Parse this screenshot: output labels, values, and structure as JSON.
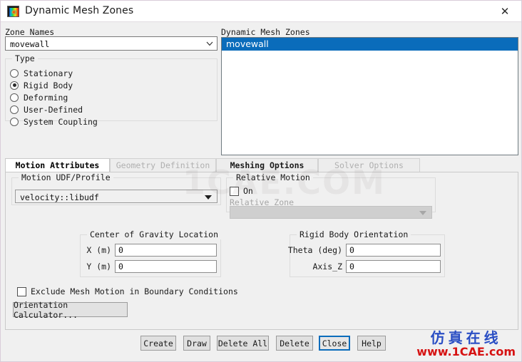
{
  "window": {
    "title": "Dynamic Mesh Zones",
    "icon": "fluent-contour-icon",
    "close_label": "✕"
  },
  "left": {
    "zone_names_label": "Zone Names",
    "zone_combo_value": "movewall",
    "type_group_label": "Type",
    "type_options": [
      {
        "label": "Stationary",
        "checked": false
      },
      {
        "label": "Rigid Body",
        "checked": true
      },
      {
        "label": "Deforming",
        "checked": false
      },
      {
        "label": "User-Defined",
        "checked": false
      },
      {
        "label": "System Coupling",
        "checked": false
      }
    ]
  },
  "right": {
    "list_label": "Dynamic Mesh Zones",
    "items": [
      {
        "label": "movewall",
        "selected": true
      }
    ]
  },
  "tabs": [
    {
      "label": "Motion Attributes",
      "active": true,
      "disabled": false
    },
    {
      "label": "Geometry Definition",
      "active": false,
      "disabled": true
    },
    {
      "label": "Meshing Options",
      "active": false,
      "disabled": false
    },
    {
      "label": "Solver Options",
      "active": false,
      "disabled": true
    }
  ],
  "motion_attributes": {
    "udf_group_label": "Motion UDF/Profile",
    "udf_value": "velocity::libudf",
    "relative_motion": {
      "group_label": "Relative Motion",
      "on_label": "On",
      "on_checked": false,
      "relative_zone_label": "Relative Zone",
      "relative_zone_value": "",
      "relative_zone_disabled": true
    },
    "center_of_gravity": {
      "group_label": "Center of Gravity Location",
      "fields": [
        {
          "label": "X (m)",
          "value": "0"
        },
        {
          "label": "Y (m)",
          "value": "0"
        }
      ]
    },
    "rigid_body_orientation": {
      "group_label": "Rigid Body Orientation",
      "fields": [
        {
          "label": "Theta (deg)",
          "value": "0"
        },
        {
          "label": "Axis_Z",
          "value": "0"
        }
      ]
    },
    "exclude_label": "Exclude Mesh Motion in Boundary Conditions",
    "exclude_checked": false,
    "orientation_calculator_label": "Orientation Calculator..."
  },
  "buttons": [
    {
      "label": "Create",
      "focused": false
    },
    {
      "label": "Draw",
      "focused": false
    },
    {
      "label": "Delete All",
      "focused": false
    },
    {
      "label": "Delete",
      "focused": false
    },
    {
      "label": "Close",
      "focused": true
    },
    {
      "label": "Help",
      "focused": false
    }
  ],
  "watermarks": {
    "center": "1CAE.COM",
    "logo_cn": "仿真在线",
    "logo_en": "www.1CAE.com"
  },
  "colors": {
    "selection_blue": "#0a6cbb",
    "focus_blue": "#0a6cbb",
    "panel_gray": "#f0f0f0",
    "logo_blue": "#2b4fc4",
    "logo_red": "#d61212"
  }
}
